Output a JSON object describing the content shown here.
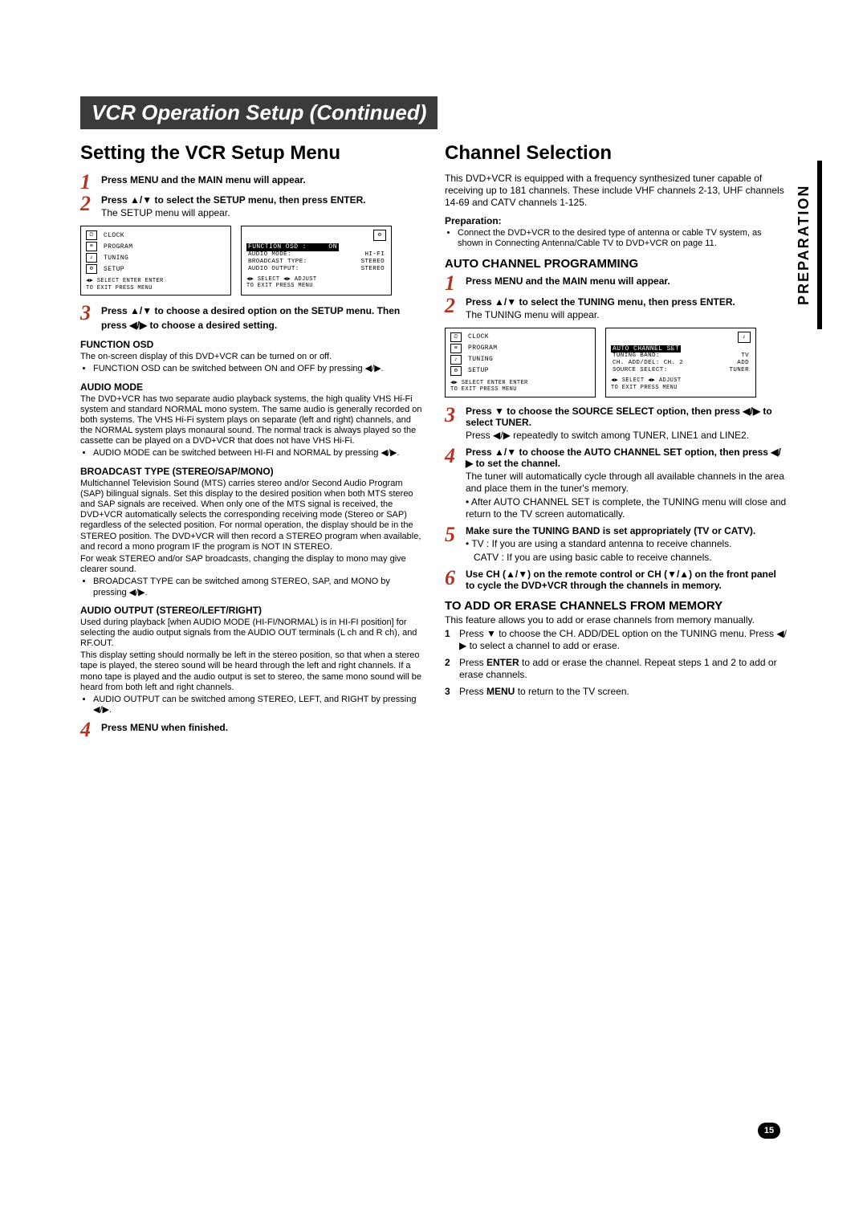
{
  "sideTab": "PREPARATION",
  "pageNumber": "15",
  "titleBar": "VCR Operation Setup (Continued)",
  "left": {
    "heading": "Setting the VCR Setup Menu",
    "step1": "Press MENU and the MAIN menu will appear.",
    "step2_lead": "Press ▲/▼ to select the SETUP menu, then press ENTER.",
    "step2_body": "The SETUP menu will appear.",
    "osdLeft": {
      "items": [
        "CLOCK",
        "PROGRAM",
        "TUNING",
        "SETUP"
      ],
      "footer1": "◀▶ SELECT  ENTER  ENTER",
      "footer2": "TO  EXIT  PRESS  MENU"
    },
    "osdRight": {
      "title": "FUNCTION OSD :",
      "titleVal": "ON",
      "rows": [
        {
          "k": "AUDIO MODE:",
          "v": "HI-FI"
        },
        {
          "k": "BROADCAST TYPE:",
          "v": "STEREO"
        },
        {
          "k": "AUDIO OUTPUT:",
          "v": "STEREO"
        }
      ],
      "footer1": "◀▶ SELECT     ◀▶ ADJUST",
      "footer2": "TO  EXIT  PRESS  MENU"
    },
    "step3": "Press ▲/▼ to choose a desired option on the SETUP menu. Then press ◀/▶ to choose a desired setting.",
    "func_h": "FUNCTION OSD",
    "func_p": "The on-screen display of this DVD+VCR can be turned on or off.",
    "func_b": "FUNCTION OSD can be switched between ON and OFF by pressing ◀/▶.",
    "audio_h": "AUDIO MODE",
    "audio_p": "The DVD+VCR has two separate audio playback systems, the high quality VHS Hi-Fi system and standard NORMAL mono system. The same audio is generally recorded on both systems. The VHS Hi-Fi system plays on separate (left and right) channels, and the NORMAL system plays monaural sound. The normal track is always played so the cassette can be played on a DVD+VCR that does not have VHS Hi-Fi.",
    "audio_b": "AUDIO MODE can be switched between HI-FI and NORMAL by pressing ◀/▶.",
    "bc_h": "BROADCAST TYPE (STEREO/SAP/MONO)",
    "bc_p1": "Multichannel Television Sound (MTS) carries stereo and/or Second Audio Program (SAP) bilingual signals. Set this display to the desired position when both MTS stereo and SAP signals are received. When only one of the MTS signal is received, the DVD+VCR automatically selects the corresponding receiving mode (Stereo or SAP) regardless of the selected position. For normal operation, the display should be in the STEREO position. The DVD+VCR will then record a STEREO program when available, and record a mono program IF the program is NOT IN STEREO.",
    "bc_p2": "For weak STEREO and/or SAP broadcasts, changing the display to mono may give clearer sound.",
    "bc_b": "BROADCAST TYPE can be switched among STEREO, SAP, and MONO by pressing ◀/▶.",
    "ao_h": "AUDIO OUTPUT (STEREO/LEFT/RIGHT)",
    "ao_p1": "Used during playback [when AUDIO MODE (HI-FI/NORMAL) is in HI-FI position] for selecting the audio output signals from the AUDIO OUT terminals (L ch and R ch), and RF.OUT.",
    "ao_p2": "This display setting should normally be left in the stereo position, so that when a stereo tape is played, the stereo sound will be heard through the left and right channels. If a mono tape is played and the audio output is set to stereo, the same mono sound will be heard from both left and right channels.",
    "ao_b": "AUDIO OUTPUT can be switched among STEREO, LEFT, and RIGHT by pressing ◀/▶.",
    "step4": "Press MENU when finished."
  },
  "right": {
    "heading": "Channel Selection",
    "intro": "This DVD+VCR is equipped with a frequency synthesized tuner capable of receiving up to 181 channels. These include VHF channels 2-13, UHF channels 14-69 and CATV channels 1-125.",
    "prep_h": "Preparation:",
    "prep_b": "Connect the DVD+VCR to the desired type of antenna or cable TV system, as shown in Connecting Antenna/Cable TV to DVD+VCR on page 11.",
    "auto_h": "AUTO CHANNEL PROGRAMMING",
    "a1": "Press MENU and the MAIN menu will appear.",
    "a2_lead": "Press ▲/▼ to select the TUNING menu, then press ENTER.",
    "a2_body": "The TUNING menu will appear.",
    "osdLeft": {
      "items": [
        "CLOCK",
        "PROGRAM",
        "TUNING",
        "SETUP"
      ],
      "footer1": "◀▶ SELECT  ENTER  ENTER",
      "footer2": "TO  EXIT  PRESS  MENU"
    },
    "osdRight": {
      "title": "AUTO CHANNEL SET",
      "rows": [
        {
          "k": "TUNING BAND:",
          "v": "TV"
        },
        {
          "k": "CH.  ADD/DEL: CH. 2",
          "v": "ADD"
        },
        {
          "k": "SOURCE SELECT:",
          "v": "TUNER"
        }
      ],
      "footer1": "◀▶ SELECT     ◀▶ ADJUST",
      "footer2": "TO  EXIT  PRESS  MENU"
    },
    "a3_lead": "Press ▼ to choose the SOURCE SELECT option, then press ◀/▶ to select TUNER.",
    "a3_body": "Press ◀/▶ repeatedly to switch among TUNER, LINE1 and LINE2.",
    "a4_lead": "Press ▲/▼ to choose the AUTO CHANNEL SET option, then press ◀/▶ to set the channel.",
    "a4_b1": "The tuner will automatically cycle through all available channels in the area and place them in the tuner's memory.",
    "a4_b2": "• After AUTO CHANNEL SET is complete, the TUNING menu will close and return to the TV screen automatically.",
    "a5_lead": "Make sure the TUNING BAND is set appropriately (TV or CATV).",
    "a5_b1": "• TV : If you are using a standard antenna to receive channels.",
    "a5_b2": "CATV : If you are using basic cable to receive channels.",
    "a6_lead": "Use CH (▲/▼) on the remote control or CH (▼/▲) on the front panel to cycle the DVD+VCR through the channels in memory.",
    "mem_h": "TO ADD OR ERASE CHANNELS FROM MEMORY",
    "mem_p": "This feature allows you to add or erase channels from memory manually.",
    "m1": "Press ▼ to choose the CH. ADD/DEL option on the TUNING menu. Press ◀/▶ to select a channel to add or erase.",
    "m2a": "Press ",
    "m2b": "ENTER",
    "m2c": " to add or erase the channel. Repeat steps 1 and 2 to add or erase channels.",
    "m3a": "Press ",
    "m3b": "MENU",
    "m3c": " to return to the TV screen."
  }
}
